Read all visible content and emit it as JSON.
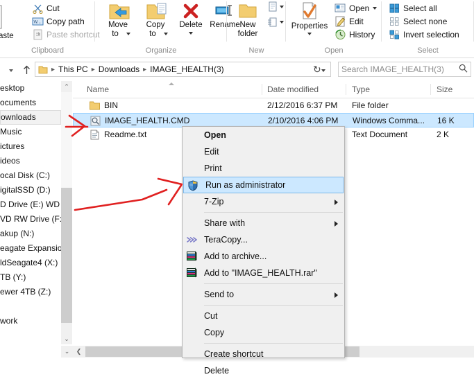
{
  "ribbon": {
    "groups": [
      {
        "label": "Clipboard"
      },
      {
        "label": "Organize"
      },
      {
        "label": "New"
      },
      {
        "label": "Open"
      },
      {
        "label": "Select"
      }
    ],
    "clipboard": {
      "paste_label": "Paste",
      "paste_icon": "clipboard-icon",
      "items": [
        {
          "label": "Cut",
          "icon": "scissors-icon",
          "disabled": false
        },
        {
          "label": "Copy path",
          "icon": "copy-path-icon",
          "disabled": false
        },
        {
          "label": "Paste shortcut",
          "icon": "paste-shortcut-icon",
          "disabled": true
        }
      ]
    },
    "organize": {
      "move_to": "Move\nto",
      "move_to_line1": "Move",
      "move_to_line2": "to",
      "copy_to_line1": "Copy",
      "copy_to_line2": "to",
      "delete_label": "Delete",
      "rename_label": "Rename",
      "move_icon": "move-to-folder-icon",
      "copy_icon": "copy-to-folder-icon",
      "delete_icon": "red-x-icon",
      "rename_icon": "rename-icon"
    },
    "new": {
      "new_folder_line1": "New",
      "new_folder_line2": "folder",
      "new_folder_icon": "new-folder-icon",
      "new_item_icon": "new-item-icon",
      "easy_access_icon": "easy-access-icon"
    },
    "open": {
      "properties_label": "Properties",
      "properties_icon": "properties-icon",
      "items": [
        {
          "label": "Open",
          "icon": "open-icon",
          "caret": true
        },
        {
          "label": "Edit",
          "icon": "edit-pencil-icon",
          "caret": false
        },
        {
          "label": "History",
          "icon": "history-clock-icon",
          "caret": false
        }
      ]
    },
    "select": {
      "items": [
        {
          "label": "Select all",
          "icon": "select-all-icon"
        },
        {
          "label": "Select none",
          "icon": "select-none-icon"
        },
        {
          "label": "Invert selection",
          "icon": "invert-selection-icon"
        }
      ]
    }
  },
  "address": {
    "recent_icon": "chevron-down-icon",
    "up_icon": "arrow-up-icon",
    "folder_icon": "folder-icon",
    "crumbs": [
      "This PC",
      "Downloads",
      "IMAGE_HEALTH(3)"
    ],
    "dropdown_icon": "chevron-down-icon",
    "refresh_icon": "refresh-icon",
    "refresh_glyph": "↻"
  },
  "search": {
    "placeholder": "Search IMAGE_HEALTH(3)",
    "icon": "search-icon"
  },
  "nav_pane": {
    "items": [
      {
        "label": "esktop",
        "selected": false
      },
      {
        "label": "ocuments",
        "selected": false
      },
      {
        "label": "ownloads",
        "selected": true
      },
      {
        "label": "Music",
        "selected": false
      },
      {
        "label": "ictures",
        "selected": false
      },
      {
        "label": "ideos",
        "selected": false
      },
      {
        "label": "ocal Disk (C:)",
        "selected": false
      },
      {
        "label": "igitalSSD (D:)",
        "selected": false
      },
      {
        "label": "D Drive (E:) WD S",
        "selected": false
      },
      {
        "label": "VD RW Drive (F:) .",
        "selected": false
      },
      {
        "label": "akup (N:)",
        "selected": false
      },
      {
        "label": "eagate Expansion",
        "selected": false
      },
      {
        "label": "ldSeagate4 (X:)",
        "selected": false
      },
      {
        "label": "TB (Y:)",
        "selected": false
      },
      {
        "label": "ewer 4TB (Z:)",
        "selected": false
      },
      {
        "label": "",
        "selected": false
      },
      {
        "label": "work",
        "selected": false
      }
    ],
    "scrollbar": {
      "up_glyph": "⌃",
      "down_glyph": "⌄"
    }
  },
  "file_list": {
    "columns": [
      {
        "label": "Name",
        "sorted": true
      },
      {
        "label": "Date modified",
        "sorted": false
      },
      {
        "label": "Type",
        "sorted": false
      },
      {
        "label": "Size",
        "sorted": false
      }
    ],
    "rows": [
      {
        "name": "BIN",
        "date": "2/12/2016 6:37 PM",
        "type": "File folder",
        "size": "",
        "icon": "folder-icon",
        "selected": false
      },
      {
        "name": "IMAGE_HEALTH.CMD",
        "date": "2/10/2016 4:06 PM",
        "type": "Windows Comma...",
        "size": "16 K",
        "icon": "cmd-script-icon",
        "selected": true
      },
      {
        "name": "Readme.txt",
        "date": "",
        "type": "Text Document",
        "size": "2 K",
        "icon": "text-file-icon",
        "selected": false
      }
    ],
    "hscroll": {
      "down_glyph": "⌄",
      "left_glyph": "❮"
    }
  },
  "context_menu": {
    "items": [
      {
        "label": "Open",
        "bold": true,
        "icon": null,
        "submenu": false,
        "highlighted": false,
        "separator_after": false
      },
      {
        "label": "Edit",
        "bold": false,
        "icon": null,
        "submenu": false,
        "highlighted": false,
        "separator_after": false
      },
      {
        "label": "Print",
        "bold": false,
        "icon": null,
        "submenu": false,
        "highlighted": false,
        "separator_after": false
      },
      {
        "label": "Run as administrator",
        "bold": false,
        "icon": "uac-shield-icon",
        "submenu": false,
        "highlighted": true,
        "separator_after": false
      },
      {
        "label": "7-Zip",
        "bold": false,
        "icon": null,
        "submenu": true,
        "highlighted": false,
        "separator_after": true
      },
      {
        "label": "Share with",
        "bold": false,
        "icon": null,
        "submenu": true,
        "highlighted": false,
        "separator_after": false
      },
      {
        "label": "TeraCopy...",
        "bold": false,
        "icon": "teracopy-icon",
        "submenu": false,
        "highlighted": false,
        "separator_after": false
      },
      {
        "label": "Add to archive...",
        "bold": false,
        "icon": "winrar-icon",
        "submenu": false,
        "highlighted": false,
        "separator_after": false
      },
      {
        "label": "Add to \"IMAGE_HEALTH.rar\"",
        "bold": false,
        "icon": "winrar-icon",
        "submenu": false,
        "highlighted": false,
        "separator_after": true
      },
      {
        "label": "Send to",
        "bold": false,
        "icon": null,
        "submenu": true,
        "highlighted": false,
        "separator_after": true
      },
      {
        "label": "Cut",
        "bold": false,
        "icon": null,
        "submenu": false,
        "highlighted": false,
        "separator_after": false
      },
      {
        "label": "Copy",
        "bold": false,
        "icon": null,
        "submenu": false,
        "highlighted": false,
        "separator_after": true
      },
      {
        "label": "Create shortcut",
        "bold": false,
        "icon": null,
        "submenu": false,
        "highlighted": false,
        "separator_after": false
      },
      {
        "label": "Delete",
        "bold": false,
        "icon": null,
        "submenu": false,
        "highlighted": false,
        "separator_after": false
      }
    ]
  },
  "annotations": {
    "arrow_to_file": "red-arrow-pointing-to-selected-file",
    "arrow_to_runas": "red-arrow-pointing-to-run-as-administrator",
    "color": "#e02020"
  },
  "colors": {
    "selection_fill": "#cce8ff",
    "selection_border": "#99d1ff",
    "menu_bg": "#f0f0f0",
    "annotation_red": "#e02020"
  }
}
